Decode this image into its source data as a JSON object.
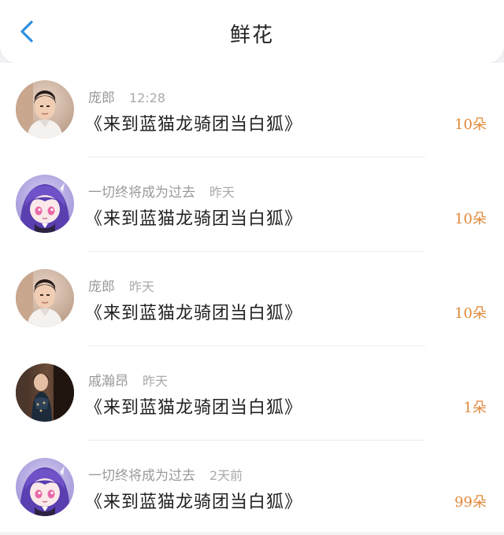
{
  "header": {
    "title": "鲜花",
    "back_icon": "chevron-left-icon",
    "accent_color": "#2f8fe0"
  },
  "gifts": [
    {
      "user": "庞郎",
      "time": "12:28",
      "book": "《来到蓝猫龙骑团当白狐》",
      "amount": "10朵",
      "avatar": "man-portrait"
    },
    {
      "user": "一切终将成为过去",
      "time": "昨天",
      "book": "《来到蓝猫龙骑团当白狐》",
      "amount": "10朵",
      "avatar": "anime-girl-purple"
    },
    {
      "user": "庞郎",
      "time": "昨天",
      "book": "《来到蓝猫龙骑团当白狐》",
      "amount": "10朵",
      "avatar": "man-portrait"
    },
    {
      "user": "戚瀚昂",
      "time": "昨天",
      "book": "《来到蓝猫龙骑团当白狐》",
      "amount": "1朵",
      "avatar": "woman-dark-photo"
    },
    {
      "user": "一切终将成为过去",
      "time": "2天前",
      "book": "《来到蓝猫龙骑团当白狐》",
      "amount": "99朵",
      "avatar": "anime-girl-purple"
    }
  ],
  "colors": {
    "amount": "#e0893b",
    "meta": "#9a9a9a"
  }
}
